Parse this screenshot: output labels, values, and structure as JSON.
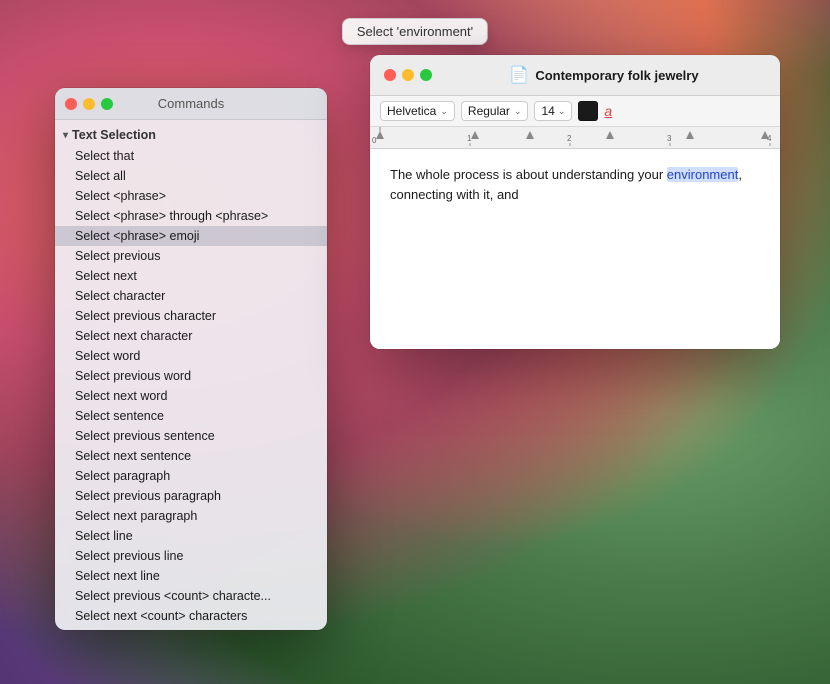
{
  "desktop": {
    "tooltip": "Select 'environment'"
  },
  "commands_window": {
    "title": "Commands",
    "section": {
      "label": "Text Selection",
      "chevron": "▾"
    },
    "items": [
      {
        "label": "Select that",
        "highlighted": false
      },
      {
        "label": "Select all",
        "highlighted": false
      },
      {
        "label": "Select <phrase>",
        "highlighted": false
      },
      {
        "label": "Select <phrase> through <phrase>",
        "highlighted": false
      },
      {
        "label": "Select <phrase> emoji",
        "highlighted": true
      },
      {
        "label": "Select previous",
        "highlighted": false
      },
      {
        "label": "Select next",
        "highlighted": false
      },
      {
        "label": "Select character",
        "highlighted": false
      },
      {
        "label": "Select previous character",
        "highlighted": false
      },
      {
        "label": "Select next character",
        "highlighted": false
      },
      {
        "label": "Select word",
        "highlighted": false
      },
      {
        "label": "Select previous word",
        "highlighted": false
      },
      {
        "label": "Select next word",
        "highlighted": false
      },
      {
        "label": "Select sentence",
        "highlighted": false
      },
      {
        "label": "Select previous sentence",
        "highlighted": false
      },
      {
        "label": "Select next sentence",
        "highlighted": false
      },
      {
        "label": "Select paragraph",
        "highlighted": false
      },
      {
        "label": "Select previous paragraph",
        "highlighted": false
      },
      {
        "label": "Select next paragraph",
        "highlighted": false
      },
      {
        "label": "Select line",
        "highlighted": false
      },
      {
        "label": "Select previous line",
        "highlighted": false
      },
      {
        "label": "Select next line",
        "highlighted": false
      },
      {
        "label": "Select previous <count> characte...",
        "highlighted": false
      },
      {
        "label": "Select next <count> characters",
        "highlighted": false
      }
    ]
  },
  "editor_window": {
    "title": "Contemporary folk jewelry",
    "doc_icon": "📄",
    "controls": {
      "close": "#ff5f57",
      "minimize": "#febc2e",
      "maximize": "#28c840"
    },
    "toolbar": {
      "font": "Helvetica",
      "style": "Regular",
      "size": "14",
      "font_placeholder": "Helvetica",
      "style_placeholder": "Regular",
      "size_placeholder": "14"
    },
    "content": {
      "text_before": "The whole process is about understanding your ",
      "highlighted": "environment",
      "text_after": ", connecting with it, and"
    }
  }
}
